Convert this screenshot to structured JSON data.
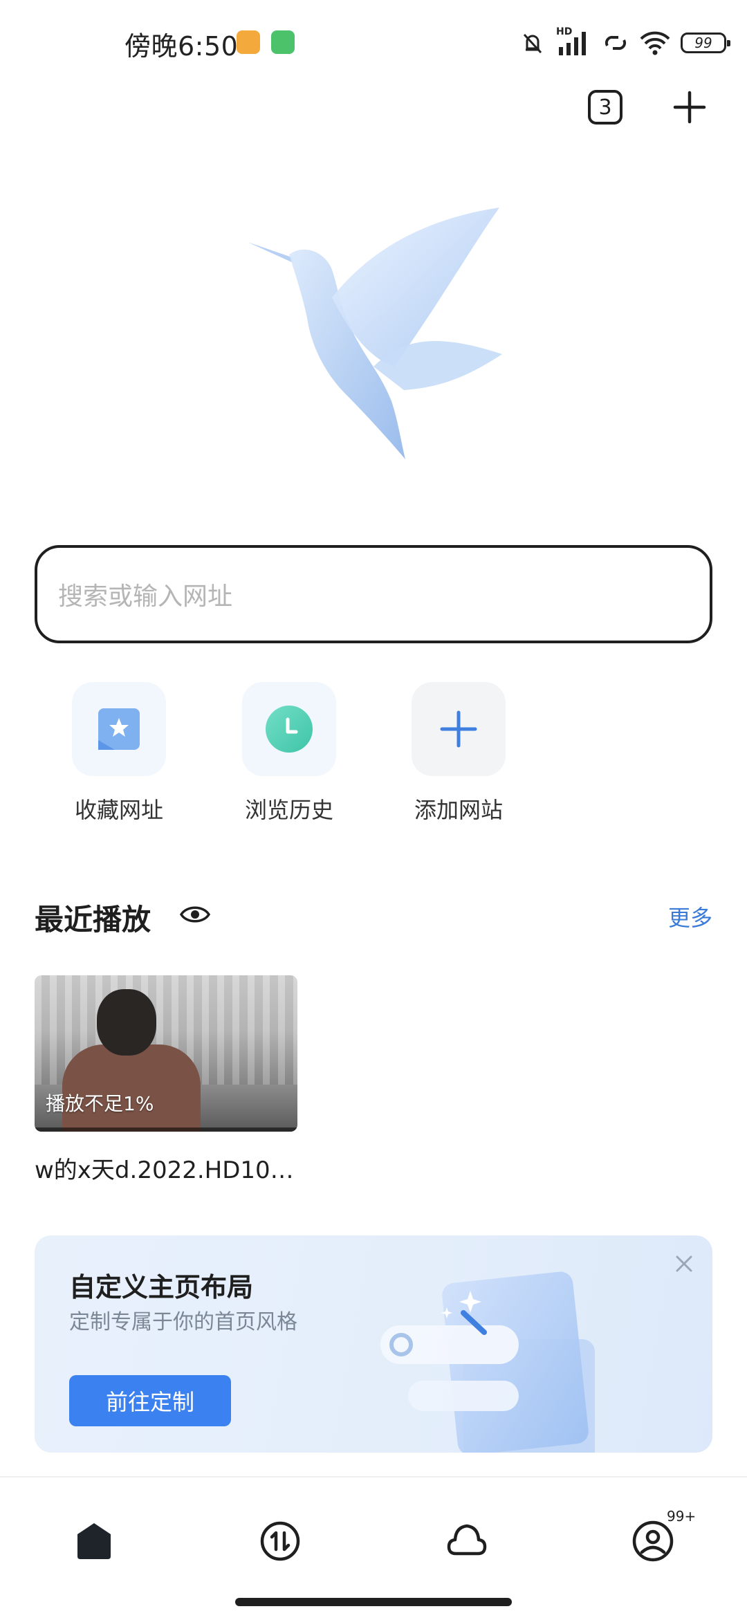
{
  "status_bar": {
    "time": "傍晚6:50",
    "network": "HD",
    "battery": "99"
  },
  "toolbar": {
    "tab_count": "3"
  },
  "search": {
    "placeholder": "搜索或输入网址"
  },
  "quick_links": [
    {
      "label": "收藏网址",
      "icon": "bookmark-star-icon"
    },
    {
      "label": "浏览历史",
      "icon": "clock-icon"
    },
    {
      "label": "添加网站",
      "icon": "plus-icon"
    }
  ],
  "recent": {
    "title": "最近播放",
    "more": "更多",
    "items": [
      {
        "title": "w的x天d.2022.HD10…",
        "progress_text": "播放不足1%"
      }
    ]
  },
  "promo": {
    "title": "自定义主页布局",
    "subtitle": "定制专属于你的首页风格",
    "button": "前往定制"
  },
  "bottom_nav": {
    "items": [
      {
        "name": "home",
        "icon": "home-icon"
      },
      {
        "name": "transfer",
        "icon": "transfer-icon"
      },
      {
        "name": "cloud",
        "icon": "cloud-icon"
      },
      {
        "name": "profile",
        "icon": "profile-icon"
      }
    ],
    "profile_badge": "99+"
  },
  "colors": {
    "accent": "#3b82f0",
    "link": "#3a7ad8",
    "text": "#1f1f1f"
  }
}
